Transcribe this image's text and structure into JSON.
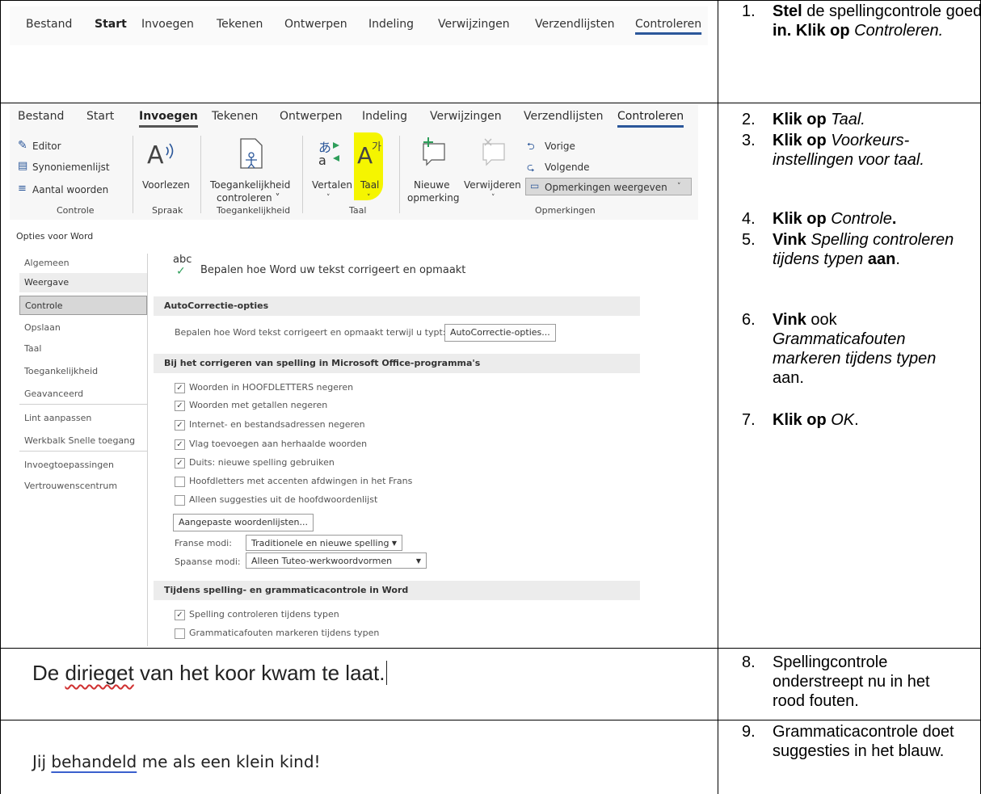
{
  "ribbon_tabs_row1": [
    "Bestand",
    "Start",
    "Invoegen",
    "Tekenen",
    "Ontwerpen",
    "Indeling",
    "Verwijzingen",
    "Verzendlijsten",
    "Controleren"
  ],
  "ribbon_tabs_row2": [
    "Bestand",
    "Start",
    "Invoegen",
    "Tekenen",
    "Ontwerpen",
    "Indeling",
    "Verwijzingen",
    "Verzendlijsten",
    "Controleren"
  ],
  "ribbon": {
    "editor": "Editor",
    "synonyms": "Synoniemenlijst",
    "wordcount": "Aantal woorden",
    "read_aloud": "Voorlezen",
    "access_1": "Toegankelijkheid",
    "access_2": "controleren ˅",
    "translate": "Vertalen",
    "language": "Taal",
    "new_comment_1": "Nieuwe",
    "new_comment_2": "opmerking",
    "delete": "Verwijderen",
    "previous": "Vorige",
    "next": "Volgende",
    "show_comments": "Opmerkingen weergeven",
    "groups": [
      "Controle",
      "Spraak",
      "Toegankelijkheid",
      "Taal",
      "Opmerkingen"
    ]
  },
  "dialog": {
    "title": "Opties voor Word",
    "sidebar": [
      "Algemeen",
      "Weergave",
      "Controle",
      "Opslaan",
      "Taal",
      "Toegankelijkheid",
      "Geavanceerd",
      "Lint aanpassen",
      "Werkbalk Snelle toegang",
      "Invoegtoepassingen",
      "Vertrouwenscentrum"
    ],
    "header": "Bepalen hoe Word uw tekst corrigeert en opmaakt",
    "abc": "abc",
    "autocorrect_section": "AutoCorrectie-opties",
    "autocorrect_text": "Bepalen hoe Word tekst corrigeert en opmaakt terwijl u typt:",
    "autocorrect_button": "AutoCorrectie-opties...",
    "office_section": "Bij het corrigeren van spelling in Microsoft Office-programma's",
    "office_options": [
      {
        "label": "Woorden in HOOFDLETTERS negeren",
        "checked": true
      },
      {
        "label": "Woorden met getallen negeren",
        "checked": true
      },
      {
        "label": "Internet- en bestandsadressen negeren",
        "checked": true
      },
      {
        "label": "Vlag toevoegen aan herhaalde woorden",
        "checked": true
      },
      {
        "label": "Duits: nieuwe spelling gebruiken",
        "checked": true
      },
      {
        "label": "Hoofdletters met accenten afdwingen in het Frans",
        "checked": false
      },
      {
        "label": "Alleen suggesties uit de hoofdwoordenlijst",
        "checked": false
      }
    ],
    "custom_dict_button": "Aangepaste woordenlijsten...",
    "french_label": "Franse modi:",
    "french_value": "Traditionele en nieuwe spelling",
    "spanish_label": "Spaanse modi:",
    "spanish_value": "Alleen Tuteo-werkwoordvormen",
    "word_section": "Tijdens spelling- en grammaticacontrole in Word",
    "word_options": [
      {
        "label": "Spelling controleren tijdens typen",
        "checked": true
      },
      {
        "label": "Grammaticafouten markeren tijdens typen",
        "checked": false
      }
    ]
  },
  "examples": {
    "spelling_before": "De ",
    "spelling_error": "dirieget",
    "spelling_after": " van het koor kwam te laat.",
    "grammar_before": "Jij ",
    "grammar_error": "behandeld",
    "grammar_after": " me als een klein kind!"
  },
  "steps": {
    "s1_num": "1.",
    "s1_a": "Stel",
    "s1_b": " de spellingcontrole goed ",
    "s1_c": "in. Klik op",
    "s1_d": "Controleren.",
    "s2_num": "2.",
    "s2_a": "Klik op",
    "s2_b": "Taal.",
    "s3_num": "3.",
    "s3_a": "Klik op",
    "s3_b": "Voorkeurs-instellingen voor taal.",
    "s4_num": "4.",
    "s4_a": "Klik op",
    "s4_b": "Controle",
    "s4_c": ".",
    "s5_num": "5.",
    "s5_a": "Vink",
    "s5_b": "Spelling controleren tijdens typen",
    "s5_c": "aan",
    "s6_num": "6.",
    "s6_a": "Vink",
    "s6_b": " ook ",
    "s6_c": "Grammaticafouten markeren tijdens typen",
    "s6_d": " aan.",
    "s7_num": "7.",
    "s7_a": "Klik op",
    "s7_b": "OK",
    "s8_num": "8.",
    "s8_text": "Spellingcontrole onderstreept nu in het rood fouten.",
    "s9_num": "9.",
    "s9_text": "Grammaticacontrole doet suggesties in het blauw."
  },
  "colors": {
    "highlight": "#f5f500",
    "accent": "#2b579a",
    "error_red": "#d03030",
    "grammar_blue": "#3a5fcd"
  }
}
